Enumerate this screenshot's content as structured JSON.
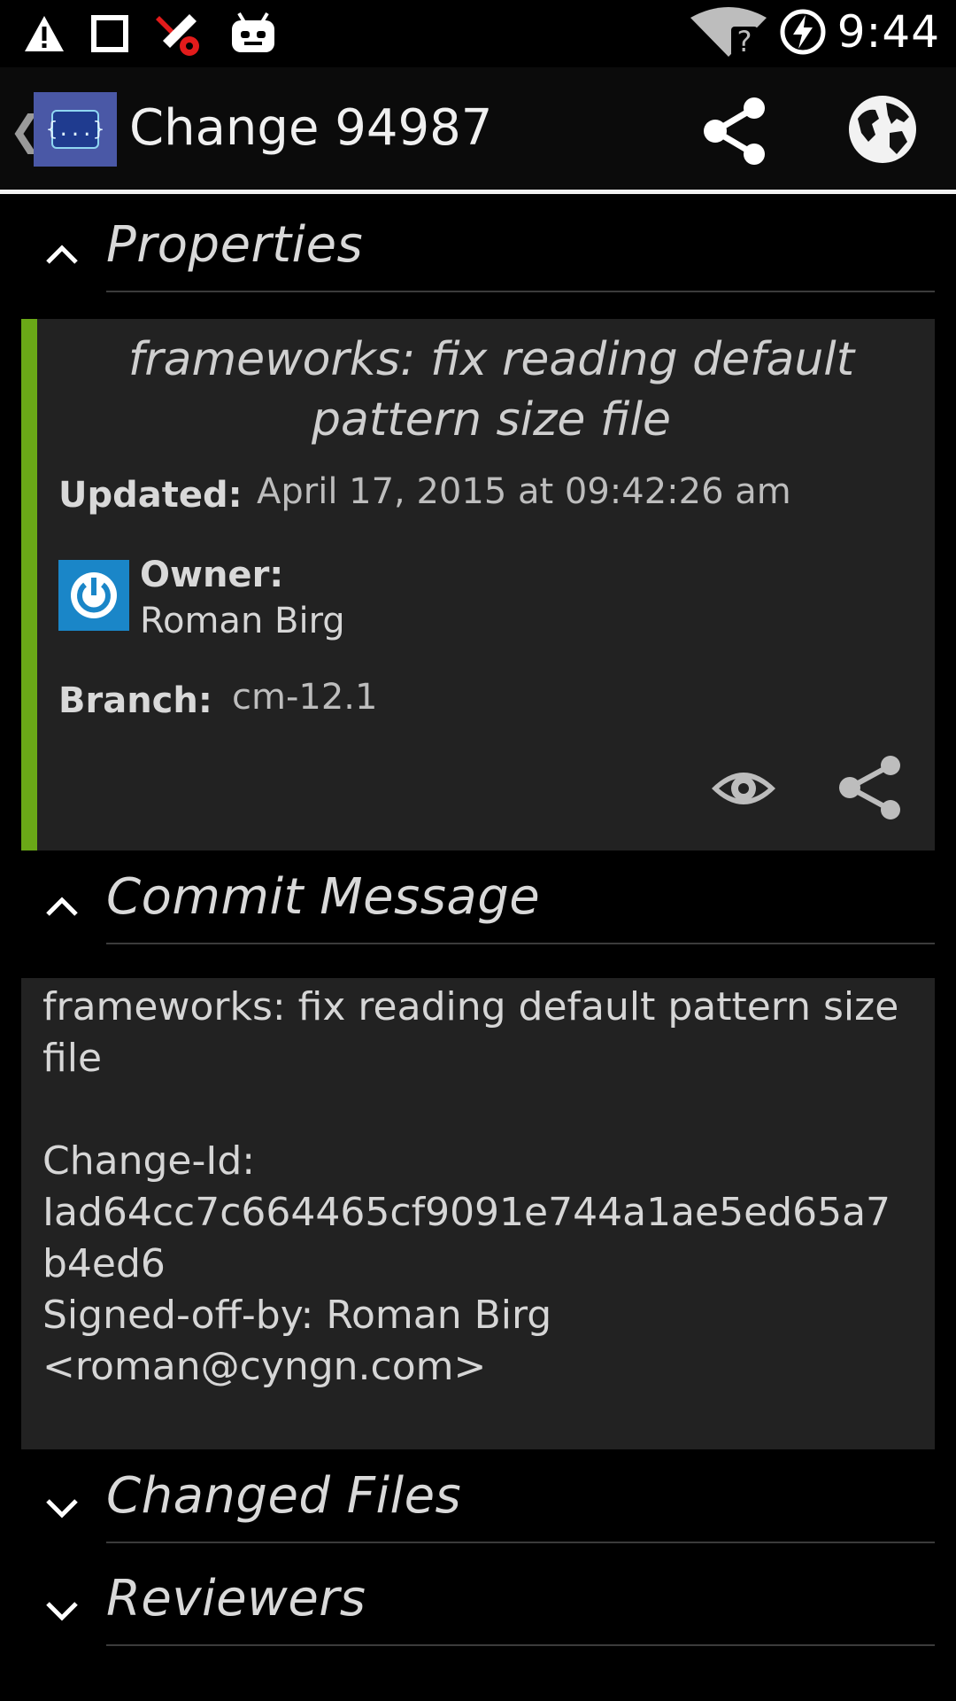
{
  "status_bar": {
    "time": "9:44",
    "left_icons": [
      "warning-icon",
      "square-icon",
      "tools-icon",
      "android-icon"
    ],
    "right_icons": [
      "wifi-icon",
      "battery-charging-icon"
    ]
  },
  "action_bar": {
    "back_glyph": "❮",
    "app_icon_glyph": "{...}",
    "title": "Change 94987",
    "actions": [
      "share-icon",
      "globe-icon"
    ]
  },
  "sections": {
    "properties": "Properties",
    "commit_message": "Commit Message",
    "changed_files": "Changed Files",
    "reviewers": "Reviewers"
  },
  "properties": {
    "subject": "frameworks: fix reading default pattern size file",
    "updated_label": "Updated:",
    "updated_value": "April 17, 2015 at 09:42:26 am",
    "owner_label": "Owner:",
    "owner_value": "Roman Birg",
    "branch_label": "Branch:",
    "branch_value": "cm-12.1",
    "accent_color": "#6aa817"
  },
  "commit_message": {
    "text": "frameworks: fix reading default pattern size\nfile\n\nChange-Id:\nIad64cc7c664465cf9091e744a1ae5ed65a7\nb4ed6\nSigned-off-by: Roman Birg\n<roman@cyngn.com>"
  }
}
